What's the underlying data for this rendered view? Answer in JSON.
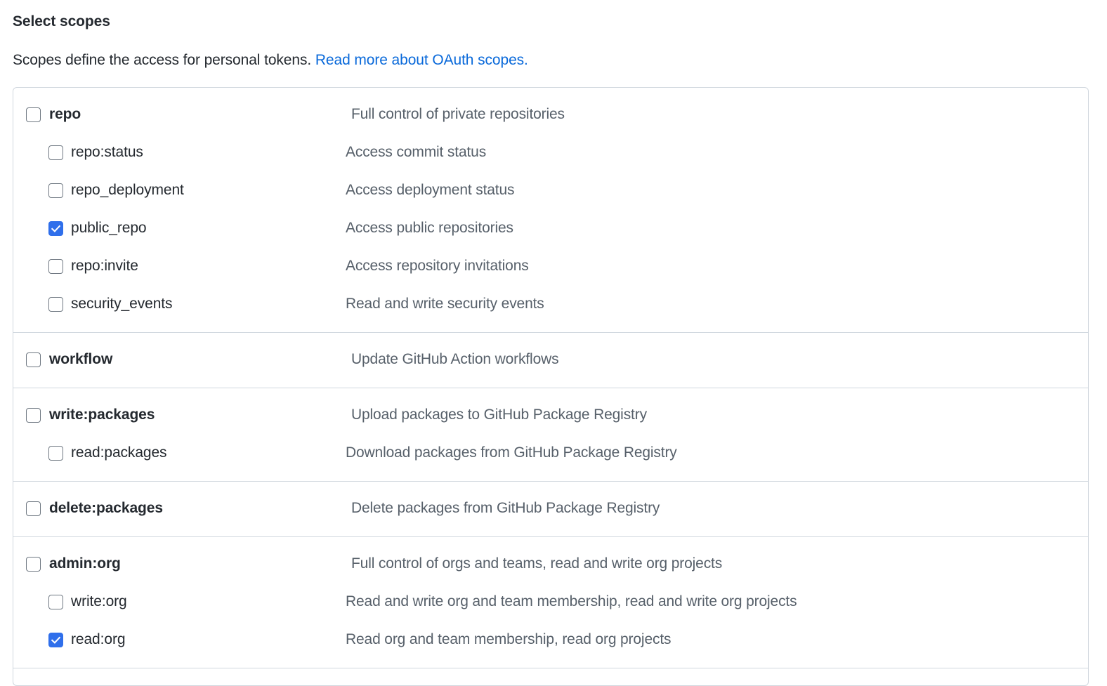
{
  "page": {
    "title": "Select scopes",
    "subtitle_text": "Scopes define the access for personal tokens.",
    "subtitle_link": "Read more about OAuth scopes."
  },
  "colors": {
    "link": "#0969da",
    "checkbox_checked": "#2f6feb",
    "checkbox_border": "#6e7781",
    "border": "#d0d7de",
    "text": "#24292f",
    "description": "#57606a"
  },
  "scope_groups": [
    {
      "rows": [
        {
          "level": "parent",
          "name": "repo",
          "description": "Full control of private repositories",
          "checked": false
        },
        {
          "level": "child",
          "name": "repo:status",
          "description": "Access commit status",
          "checked": false
        },
        {
          "level": "child",
          "name": "repo_deployment",
          "description": "Access deployment status",
          "checked": false
        },
        {
          "level": "child",
          "name": "public_repo",
          "description": "Access public repositories",
          "checked": true
        },
        {
          "level": "child",
          "name": "repo:invite",
          "description": "Access repository invitations",
          "checked": false
        },
        {
          "level": "child",
          "name": "security_events",
          "description": "Read and write security events",
          "checked": false
        }
      ]
    },
    {
      "rows": [
        {
          "level": "parent",
          "name": "workflow",
          "description": "Update GitHub Action workflows",
          "checked": false
        }
      ]
    },
    {
      "rows": [
        {
          "level": "parent",
          "name": "write:packages",
          "description": "Upload packages to GitHub Package Registry",
          "checked": false
        },
        {
          "level": "child",
          "name": "read:packages",
          "description": "Download packages from GitHub Package Registry",
          "checked": false
        }
      ]
    },
    {
      "rows": [
        {
          "level": "parent",
          "name": "delete:packages",
          "description": "Delete packages from GitHub Package Registry",
          "checked": false
        }
      ]
    },
    {
      "rows": [
        {
          "level": "parent",
          "name": "admin:org",
          "description": "Full control of orgs and teams, read and write org projects",
          "checked": false
        },
        {
          "level": "child",
          "name": "write:org",
          "description": "Read and write org and team membership, read and write org projects",
          "checked": false
        },
        {
          "level": "child",
          "name": "read:org",
          "description": "Read org and team membership, read org projects",
          "checked": true
        }
      ]
    },
    {
      "rows": []
    }
  ]
}
